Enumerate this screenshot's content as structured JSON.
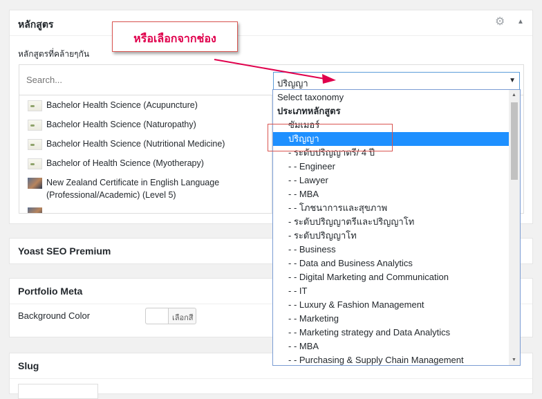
{
  "course_box": {
    "title": "หลักสูตร",
    "gear_icon": "gear-icon",
    "toggle_icon": "caret-up-icon",
    "sub_label": "หลักสูตรที่คล้ายๆกัน",
    "search_placeholder": "Search...",
    "taxonomy_selected": "ปริญญา",
    "courses": [
      {
        "label": "Bachelor Health Science (Acupuncture)",
        "thumb": "leaf"
      },
      {
        "label": "Bachelor Health Science (Naturopathy)",
        "thumb": "leaf"
      },
      {
        "label": "Bachelor Health Science (Nutritional Medicine)",
        "thumb": "leaf"
      },
      {
        "label": "Bachelor of Health Science (Myotherapy)",
        "thumb": "leaf"
      },
      {
        "label": "New Zealand Certificate in English Language",
        "label2": "(Professional/Academic) (Level 5)",
        "thumb": "photo"
      }
    ]
  },
  "yoast_box": {
    "title": "Yoast SEO Premium"
  },
  "portfolio_box": {
    "title": "Portfolio Meta",
    "background_color_label": "Background Color",
    "color_button_label": "เลือกสี"
  },
  "slug_box": {
    "title": "Slug"
  },
  "dropdown": {
    "options": [
      {
        "label": "Select taxonomy",
        "style": "normal"
      },
      {
        "label": "ประเภทหลักสูตร",
        "style": "bold"
      },
      {
        "label": "ซัมเมอร์",
        "style": "indent1"
      },
      {
        "label": "ปริญญา",
        "style": "selected"
      },
      {
        "label": "- ระดับปริญญาตรี/ 4 ปี",
        "style": "indent1"
      },
      {
        "label": "- - Engineer",
        "style": "indent1"
      },
      {
        "label": "- - Lawyer",
        "style": "indent1"
      },
      {
        "label": "- - MBA",
        "style": "indent1"
      },
      {
        "label": "- - โภชนาการและสุขภาพ",
        "style": "indent1"
      },
      {
        "label": "- ระดับปริญญาตรีและปริญญาโท",
        "style": "indent1"
      },
      {
        "label": "- ระดับปริญญาโท",
        "style": "indent1"
      },
      {
        "label": "- - Business",
        "style": "indent1"
      },
      {
        "label": "- - Data and Business Analytics",
        "style": "indent1"
      },
      {
        "label": "- - Digital Marketing and Communication",
        "style": "indent1"
      },
      {
        "label": "- - IT",
        "style": "indent1"
      },
      {
        "label": "- - Luxury & Fashion Management",
        "style": "indent1"
      },
      {
        "label": "- - Marketing",
        "style": "indent1"
      },
      {
        "label": "- - Marketing strategy and Data Analytics",
        "style": "indent1"
      },
      {
        "label": "- - MBA",
        "style": "indent1"
      },
      {
        "label": "- - Purchasing & Supply Chain Management",
        "style": "indent1"
      }
    ]
  },
  "annotation": {
    "callout_text": "หรือเลือกจากช่อง",
    "accent_color": "#e0004c",
    "frame_color": "#d9534f"
  },
  "colors": {
    "selected_bg": "#1e90ff",
    "focus_border": "#5b9dd9",
    "page_bg": "#f1f1f1"
  }
}
